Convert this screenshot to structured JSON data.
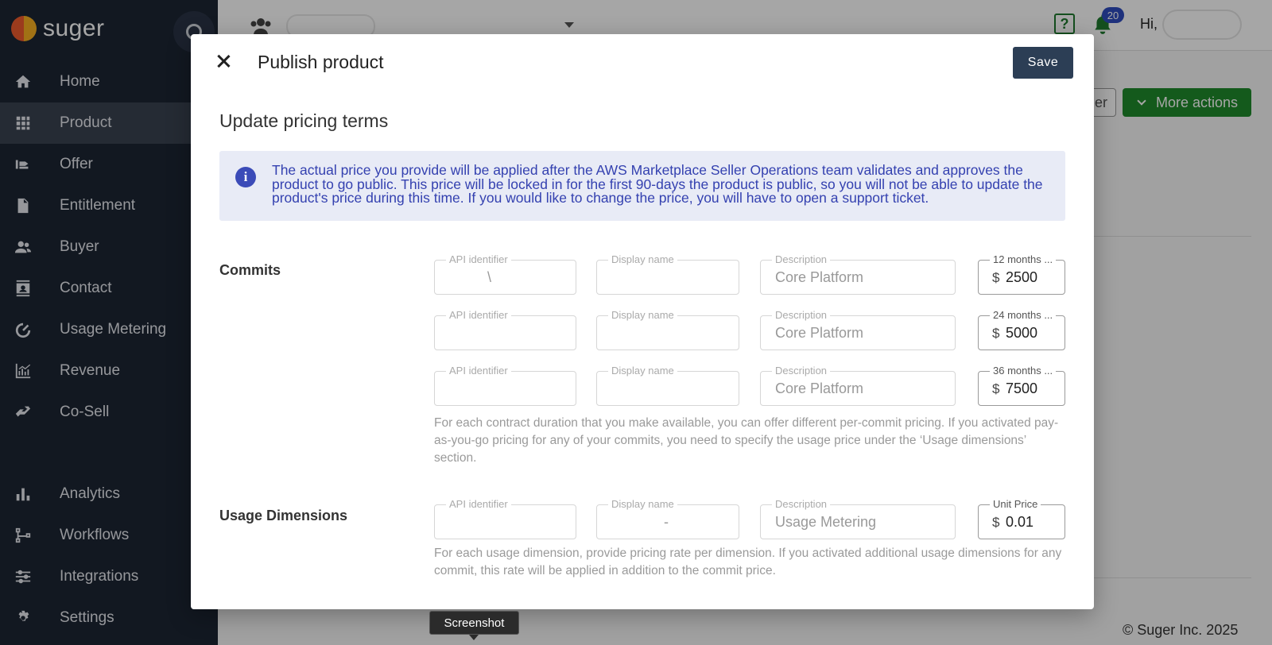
{
  "brand": {
    "name": "suger"
  },
  "sidebar": {
    "items": [
      {
        "label": "Home",
        "icon": "home-icon"
      },
      {
        "label": "Product",
        "icon": "grid-icon",
        "active": true
      },
      {
        "label": "Offer",
        "icon": "offer-icon"
      },
      {
        "label": "Entitlement",
        "icon": "document-icon"
      },
      {
        "label": "Buyer",
        "icon": "people-icon"
      },
      {
        "label": "Contact",
        "icon": "contact-card-icon"
      },
      {
        "label": "Usage Metering",
        "icon": "gauge-icon"
      },
      {
        "label": "Revenue",
        "icon": "revenue-chart-icon"
      },
      {
        "label": "Co-Sell",
        "icon": "handshake-icon"
      },
      {
        "label": "Analytics",
        "icon": "bar-chart-icon"
      },
      {
        "label": "Workflows",
        "icon": "workflow-icon"
      },
      {
        "label": "Integrations",
        "icon": "sliders-icon"
      },
      {
        "label": "Settings",
        "icon": "gear-icon"
      }
    ]
  },
  "topbar": {
    "help_icon": "?",
    "notification_count": "20",
    "greeting": "Hi,"
  },
  "background": {
    "partial_button": "er",
    "more_actions": "More actions",
    "footer": "© Suger Inc. 2025"
  },
  "modal": {
    "title": "Publish product",
    "save_label": "Save",
    "section_title": "Update pricing terms",
    "info_text": "The actual price you provide will be applied after the AWS Marketplace Seller Operations team validates and approves the product to go public. This price will be locked in for the first 90-days the product is public, so you will not be able to update the product's price during this time. If you would like to change the price, you will have to open a support ticket.",
    "field_labels": {
      "api_identifier": "API identifier",
      "display_name": "Display name",
      "description": "Description"
    },
    "commits": {
      "label": "Commits",
      "rows": [
        {
          "api_identifier": "\\",
          "display_name": "",
          "description": "Core Platform",
          "price_label": "12 months ...",
          "currency": "$",
          "price": "2500"
        },
        {
          "api_identifier": "",
          "display_name": "",
          "description": "Core Platform",
          "price_label": "24 months ...",
          "currency": "$",
          "price": "5000"
        },
        {
          "api_identifier": "",
          "display_name": "",
          "description": "Core Platform",
          "price_label": "36 months ...",
          "currency": "$",
          "price": "7500"
        }
      ],
      "helper": "For each contract duration that you make available, you can offer different per-commit pricing. If you activated pay-as-you-go pricing for any of your commits, you need to specify the usage price under the ‘Usage dimensions’ section."
    },
    "usage": {
      "label": "Usage Dimensions",
      "row": {
        "api_identifier": "",
        "display_name": "-",
        "description": "Usage Metering",
        "price_label": "Unit Price",
        "currency": "$",
        "price": "0.01"
      },
      "helper": "For each usage dimension, provide pricing rate per dimension. If you activated additional usage dimensions for any commit, this rate will be applied in addition to the commit price."
    }
  },
  "tooltip": {
    "text": "Screenshot"
  }
}
